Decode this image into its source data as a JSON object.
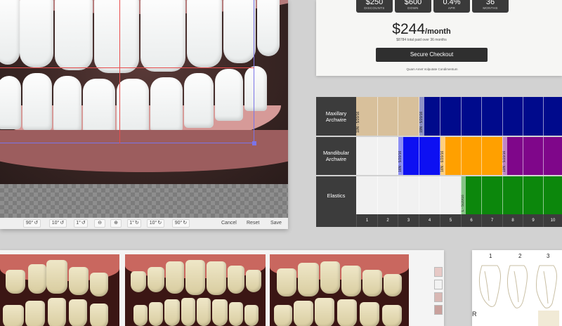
{
  "editor": {
    "toolbar": {
      "rotate_left_90": "90°",
      "rotate_left_10": "10°",
      "rotate_left_1": "1°",
      "rotate_right_1": "1°",
      "rotate_right_10": "10°",
      "rotate_right_90": "90°",
      "cancel": "Cancel",
      "reset": "Reset",
      "save": "Save"
    }
  },
  "pricing": {
    "stats": [
      {
        "value": "$250",
        "label": "DISCOUNTS"
      },
      {
        "value": "$600",
        "label": "DOWN"
      },
      {
        "value": "0.4%",
        "label": "APR"
      },
      {
        "value": "36",
        "label": "MONTHS"
      }
    ],
    "monthly_amount": "$244",
    "monthly_unit": "/month",
    "total_text": "$8784 total paid over 36 months",
    "checkout_label": "Secure Checkout",
    "footer_text": "Quam Amet Vulputate Condimentum"
  },
  "chart": {
    "rows": [
      "Maxillary Archwire",
      "Mandibular Archwire",
      "Elastics"
    ],
    "bar_tags": [
      "10N - 5/20/16",
      "19N - 5/20/16",
      "16N - 5/20/16",
      "16N - 6/20/16",
      "19N - 5/20/16",
      "L - 5/20/16"
    ],
    "ticks": [
      "1",
      "2",
      "3",
      "4",
      "5",
      "6",
      "7",
      "8",
      "9",
      "10"
    ],
    "colors": {
      "tan": "#d8c09b",
      "navy": "#000a8c",
      "blue": "#0d10f2",
      "orange": "#ffa000",
      "purple": "#7f068a",
      "green": "#0c870c"
    }
  },
  "diagram": {
    "tooth_numbers": [
      "1",
      "2",
      "3"
    ],
    "side_label": "R"
  }
}
